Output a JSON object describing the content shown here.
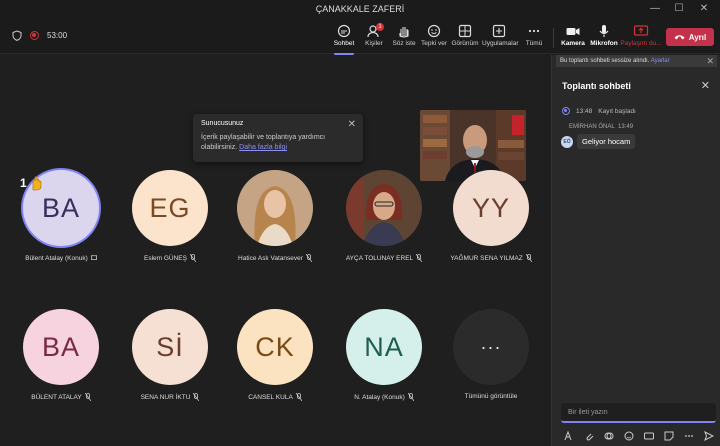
{
  "window": {
    "title": "ÇANAKKALE ZAFERİ"
  },
  "toolbar": {
    "timer": "53:00",
    "chat": "Sohbet",
    "people": "Kişiler",
    "people_badge": "1",
    "raise_hand": "Söz iste",
    "react": "Tepki ver",
    "view": "Görünüm",
    "apps": "Uygulamalar",
    "more": "Tümü",
    "camera": "Kamera",
    "mic": "Mikrofon",
    "share": "Paylaşım du...",
    "leave": "Ayrıl"
  },
  "presenter_popup": {
    "heading": "Sunucusunuz",
    "body": "İçerik paylaşabilir ve toplantıya yardımcı olabilirsiniz.",
    "link": "Daha fazla bilgi"
  },
  "raised_hand_count": "1",
  "participants": [
    {
      "initials": "BA",
      "name": "Bülent Atalay (Konuk)",
      "bg": "#dcd5ee",
      "fg": "#3b2f5c"
    },
    {
      "initials": "EG",
      "name": "Eslem GÜNEŞ",
      "bg": "#fbe3cc",
      "fg": "#7a4a25"
    },
    {
      "initials": "",
      "name": "Hatice Aslı Vatansever",
      "bg": "#b98f6e",
      "fg": "#000"
    },
    {
      "initials": "",
      "name": "AYÇA TOLUNAY EREL",
      "bg": "#6a4c3a",
      "fg": "#000"
    },
    {
      "initials": "YY",
      "name": "YAĞMUR SENA YILMAZ",
      "bg": "#f1dccf",
      "fg": "#6a3f2e"
    },
    {
      "initials": "BA",
      "name": "BÜLENT ATALAY",
      "bg": "#f6d3df",
      "fg": "#7a2a46"
    },
    {
      "initials": "Sİ",
      "name": "SENA NUR İKTU",
      "bg": "#f5e0d3",
      "fg": "#6b3d2b"
    },
    {
      "initials": "CK",
      "name": "CANSEL KULA",
      "bg": "#fbe3c2",
      "fg": "#7a4a14"
    },
    {
      "initials": "NA",
      "name": "N. Atalay (Konuk)",
      "bg": "#d5f0ea",
      "fg": "#1e5e50"
    },
    {
      "initials": "···",
      "name": "Tümünü görüntüle",
      "bg": "#2b2b2b",
      "fg": "#eee"
    }
  ],
  "chat": {
    "mute_notice": "Bu toplantı sohbeti sessize alındı.",
    "mute_link": "Ayarlar",
    "title": "Toplantı sohbeti",
    "system_time": "13:48",
    "system_text": "Kayıt başladı",
    "sender": "EMİRHAN ÖNAL",
    "sender_time": "13:49",
    "sender_initials": "EÖ",
    "message": "Geliyor hocam",
    "compose_placeholder": "Bir ileti yazın"
  },
  "colors": {
    "accent": "#7f85f5",
    "leave": "#c4314b",
    "record": "#d13438"
  }
}
